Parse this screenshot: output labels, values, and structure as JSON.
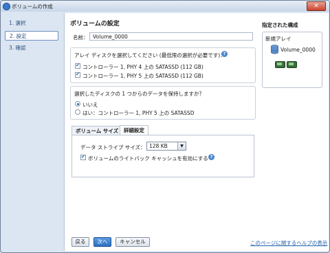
{
  "window": {
    "title": "ボリュームの作成",
    "close_label": "✕"
  },
  "sidebar": {
    "steps": [
      {
        "label": "1. 選択"
      },
      {
        "label": "2. 設定"
      },
      {
        "label": "3. 確認"
      }
    ]
  },
  "main": {
    "heading": "ボリュームの設定",
    "name_label": "名前：",
    "name_value": "Volume_0000",
    "disk_group": {
      "prompt": "アレイ ディスクを選択してください (最低限の選択が必要です)：",
      "disks": [
        {
          "label": "コントローラー 1, PHY 4 上の SATASSD (112 GB)",
          "checked": true
        },
        {
          "label": "コントローラー 1, PHY 5 上の SATASSD (112 GB)",
          "checked": true
        }
      ]
    },
    "keep_data_group": {
      "prompt": "選択したディスクの 1 つからのデータを保持しますか？",
      "options": [
        {
          "label": "いいえ",
          "selected": true
        },
        {
          "label": "はい：コントローラー 1, PHY 5 上の SATASSD",
          "selected": false
        }
      ]
    },
    "tabs": [
      {
        "label": "ボリューム サイズ"
      },
      {
        "label": "詳細設定"
      }
    ],
    "advanced": {
      "stripe_label": "データ ストライプ サイズ：",
      "stripe_value": "128 KB",
      "writeback_label": "ボリュームのライトバック キャッシュを有効にする",
      "writeback_checked": true
    }
  },
  "right_panel": {
    "title": "指定された構成",
    "array_label": "新規アレイ",
    "volume_label": "Volume_0000"
  },
  "footer": {
    "back_label": "戻る",
    "next_label": "次へ",
    "cancel_label": "キャンセル",
    "help_link": "このページに関するヘルプの表示"
  }
}
